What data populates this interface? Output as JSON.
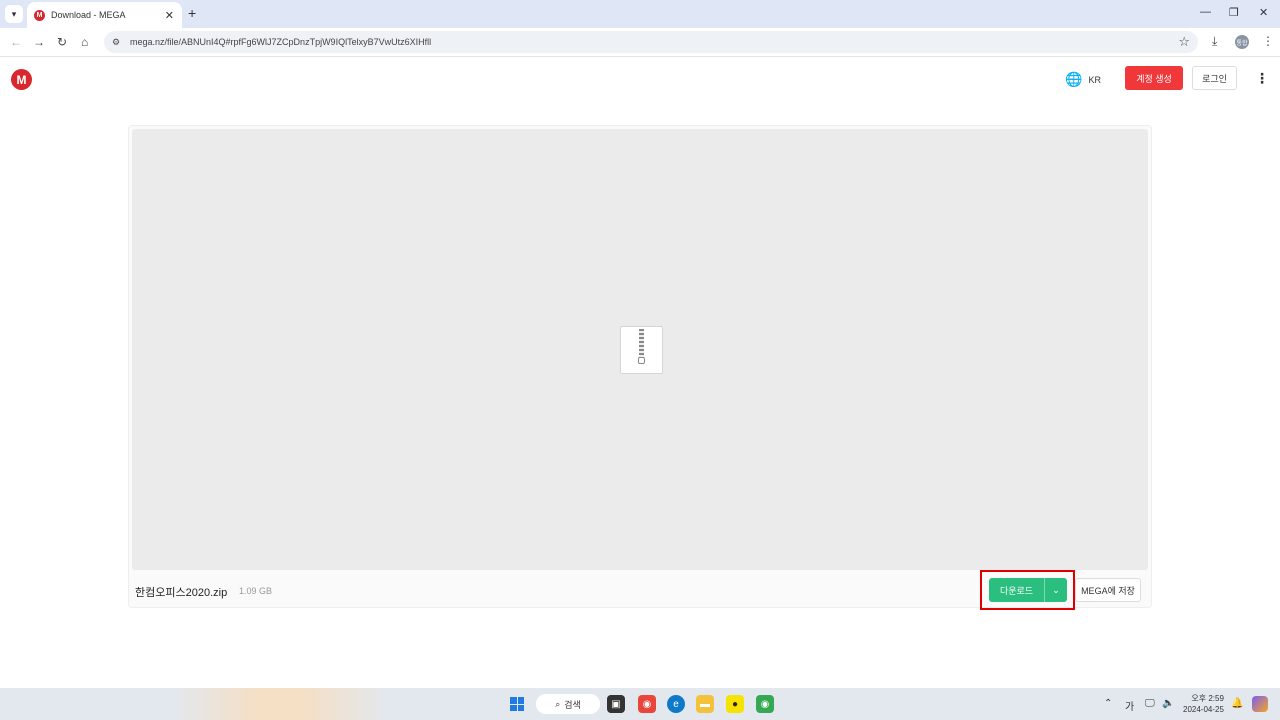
{
  "browser": {
    "tab_title": "Download - MEGA",
    "tab_favicon_letter": "M",
    "new_tab_label": "+",
    "close_tab_label": "✕",
    "url": "mega.nz/file/ABNUnI4Q#rpfFg6WlJ7ZCpDnzTpjW9IQlTelxyB7VwUtz6XIHfll",
    "window_controls": {
      "minimize": "—",
      "restore": "❐",
      "close": "✕"
    },
    "profile_initials": "통합"
  },
  "header": {
    "logo_letter": "M",
    "lang_label": "KR",
    "create_account_label": "계정 생성",
    "login_label": "로그인",
    "menu_label": "⋮"
  },
  "file": {
    "name": "한컴오피스2020.zip",
    "size": "1.09 GB",
    "download_label": "다운로드",
    "download_options_label": "⌄",
    "save_to_mega_label": "MEGA에 저장"
  },
  "taskbar": {
    "search_label": "검색",
    "tray_ime": "가",
    "clock_time": "오후 2:59",
    "clock_date": "2024-04-25"
  },
  "colors": {
    "mega_red": "#d9272e",
    "create_btn": "#f0373a",
    "download_green": "#2bbf7f",
    "highlight_red": "#e00000"
  }
}
